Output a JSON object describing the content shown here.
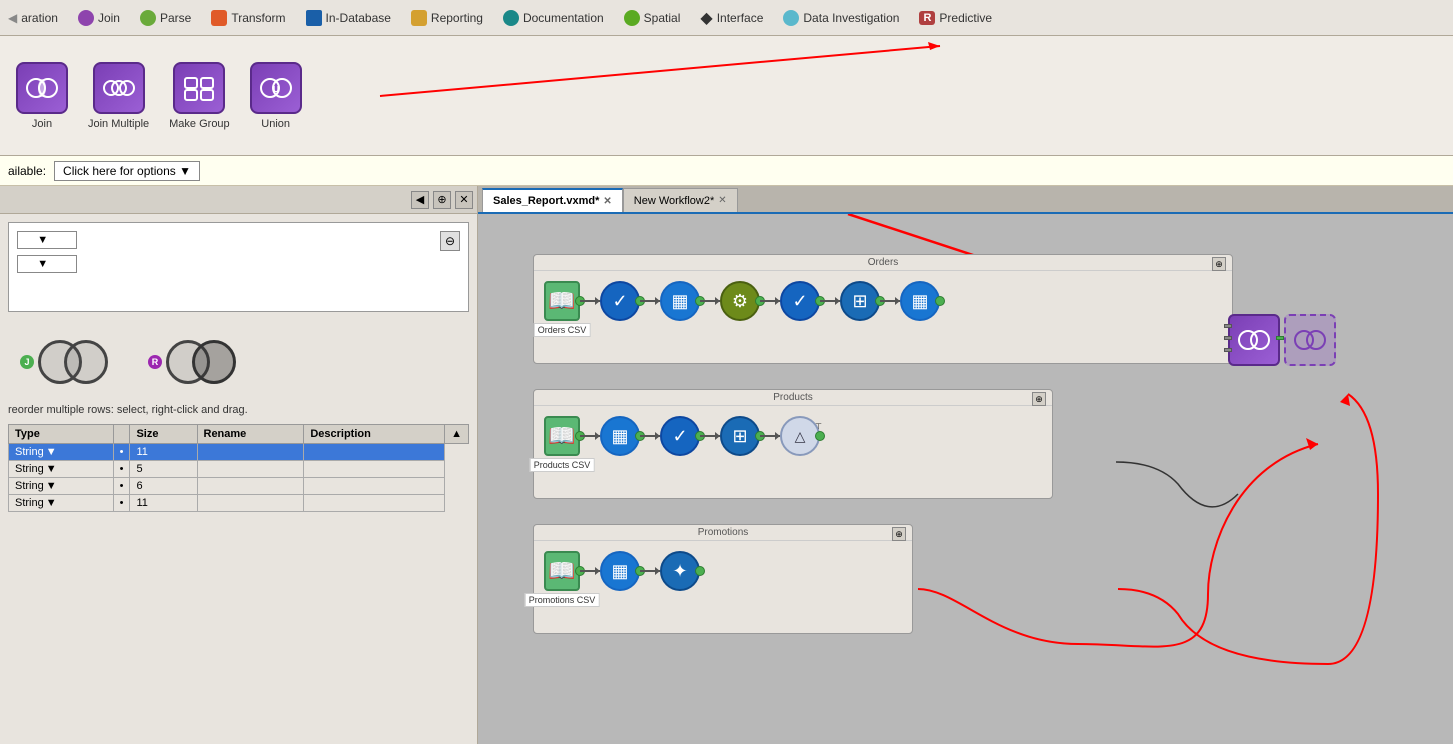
{
  "toolbar": {
    "items": [
      {
        "label": "Join",
        "color": "#8e44ad",
        "icon": "⊕"
      },
      {
        "label": "Parse",
        "color": "#6aaa3a",
        "icon": "⊞"
      },
      {
        "label": "Transform",
        "color": "#e05a28",
        "icon": "⇄"
      },
      {
        "label": "In-Database",
        "color": "#1a5fa8",
        "icon": "◉"
      },
      {
        "label": "Reporting",
        "color": "#d4a030",
        "icon": "▤"
      },
      {
        "label": "Documentation",
        "color": "#1a8888",
        "icon": "●"
      },
      {
        "label": "Spatial",
        "color": "#5aaa22",
        "icon": "◉"
      },
      {
        "label": "Interface",
        "color": "#333333",
        "icon": "◆"
      },
      {
        "label": "Data Investigation",
        "color": "#5ab8cc",
        "icon": "◉"
      },
      {
        "label": "Predictive",
        "color": "#b04040",
        "icon": "R"
      }
    ]
  },
  "palette": {
    "tools": [
      {
        "label": "Join",
        "icon": "⊕"
      },
      {
        "label": "Join Multiple",
        "icon": "⊕"
      },
      {
        "label": "Make Group",
        "icon": "⊞"
      },
      {
        "label": "Union",
        "icon": "⊕"
      }
    ]
  },
  "options_bar": {
    "available_label": "ailable:",
    "button_label": "Click here for options ▼"
  },
  "left_panel": {
    "config_dropdowns": [
      "",
      ""
    ],
    "hint": "reorder multiple rows: select, right-click and drag.",
    "table": {
      "headers": [
        "Type",
        "",
        "Size",
        "Rename",
        "Description"
      ],
      "rows": [
        {
          "type": "String",
          "size": "11",
          "rename": "",
          "description": "",
          "selected": true
        },
        {
          "type": "String",
          "size": "5",
          "rename": "",
          "description": "",
          "selected": false
        },
        {
          "type": "String",
          "size": "6",
          "rename": "",
          "description": "",
          "selected": false
        },
        {
          "type": "String",
          "size": "11",
          "rename": "",
          "description": "",
          "selected": false
        }
      ]
    },
    "join_labels": [
      "J",
      "R"
    ],
    "circle_pairs": [
      {
        "left_label": "J",
        "type": "left"
      },
      {
        "left_label": "R",
        "type": "right"
      }
    ]
  },
  "tabs": [
    {
      "label": "Sales_Report.vxmd*",
      "active": true
    },
    {
      "label": "New Workflow2*",
      "active": false
    }
  ],
  "workflows": {
    "orders": {
      "title": "Orders",
      "nodes": [
        "input",
        "check",
        "table",
        "gear",
        "check2",
        "grid",
        "table2"
      ],
      "node_label": "Orders CSV"
    },
    "products": {
      "title": "Products",
      "nodes": [
        "input",
        "table",
        "check",
        "grid",
        "triangle"
      ],
      "node_label": "Products CSV"
    },
    "promotions": {
      "title": "Promotions",
      "nodes": [
        "input",
        "table",
        "grid"
      ],
      "node_label": "Promotions CSV"
    }
  }
}
